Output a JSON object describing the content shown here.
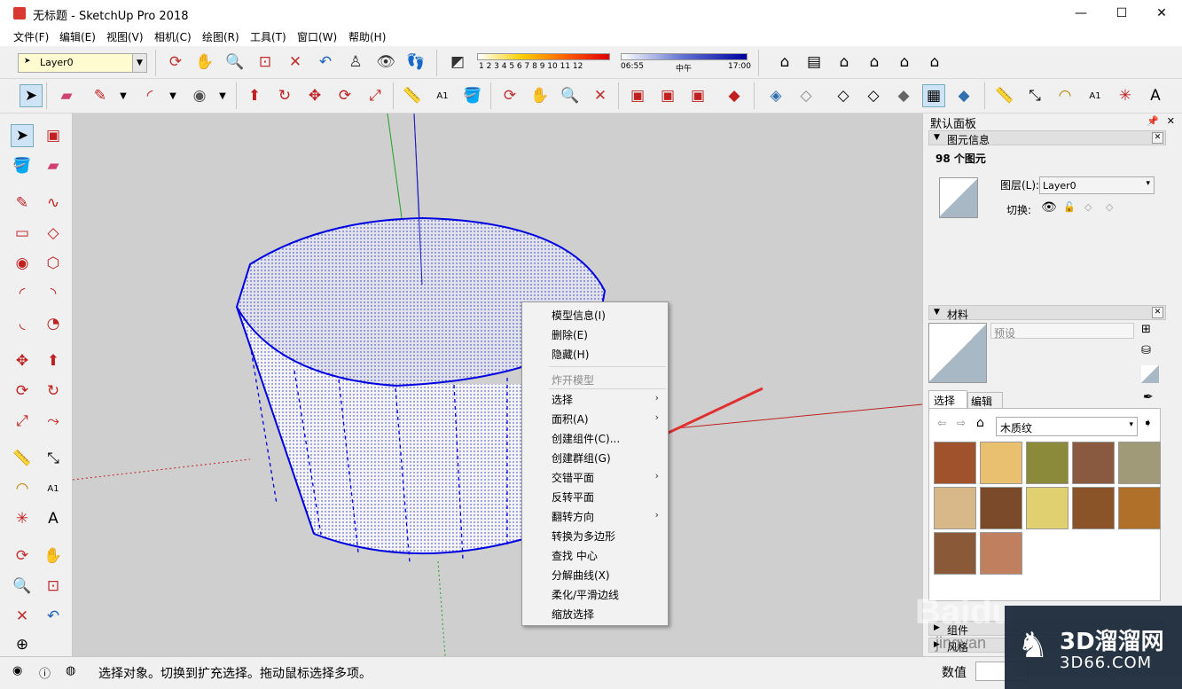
{
  "window": {
    "title": "无标题 - SketchUp Pro 2018",
    "minimize": "—",
    "maximize": "☐",
    "close": "✕"
  },
  "menu": [
    "文件(F)",
    "编辑(E)",
    "视图(V)",
    "相机(C)",
    "绘图(R)",
    "工具(T)",
    "窗口(W)",
    "帮助(H)"
  ],
  "layer_toolbar": {
    "current_layer": "Layer0"
  },
  "shadow_toolbar": {
    "months": "1 2 3 4 5 6 7 8 9 10 11 12",
    "time_start": "06:55",
    "time_mid": "中午",
    "time_end": "17:00"
  },
  "tray": {
    "title": "默认面板",
    "entity_info": {
      "header": "图元信息",
      "count": "98 个图元",
      "layer_label": "图层(L):",
      "layer_value": "Layer0",
      "toggle_label": "切换:"
    },
    "materials": {
      "header": "材料",
      "name_placeholder": "预设",
      "tab_select": "选择",
      "tab_edit": "编辑",
      "library": "木质纹"
    },
    "collapsed_panels": [
      "组件",
      "风格"
    ]
  },
  "context_menu": {
    "items": [
      {
        "label": "模型信息(I)",
        "submenu": false,
        "disabled": false
      },
      {
        "label": "删除(E)",
        "submenu": false,
        "disabled": false
      },
      {
        "label": "隐藏(H)",
        "submenu": false,
        "disabled": false
      },
      {
        "label": "炸开模型",
        "submenu": false,
        "disabled": true
      },
      {
        "label": "选择",
        "submenu": true,
        "disabled": false
      },
      {
        "label": "面积(A)",
        "submenu": true,
        "disabled": false
      },
      {
        "label": "创建组件(C)...",
        "submenu": false,
        "disabled": false
      },
      {
        "label": "创建群组(G)",
        "submenu": false,
        "disabled": false
      },
      {
        "label": "交错平面",
        "submenu": true,
        "disabled": false
      },
      {
        "label": "反转平面",
        "submenu": false,
        "disabled": false
      },
      {
        "label": "翻转方向",
        "submenu": true,
        "disabled": false
      },
      {
        "label": "转换为多边形",
        "submenu": false,
        "disabled": false
      },
      {
        "label": "查找 中心",
        "submenu": false,
        "disabled": false
      },
      {
        "label": "分解曲线(X)",
        "submenu": false,
        "disabled": false
      },
      {
        "label": "柔化/平滑边线",
        "submenu": false,
        "disabled": false
      },
      {
        "label": "缩放选择",
        "submenu": false,
        "disabled": false
      }
    ]
  },
  "status": {
    "message": "选择对象。切换到扩充选择。拖动鼠标选择多项。",
    "value_label": "数值",
    "value": ""
  },
  "watermark": {
    "line1": "3D溜溜网",
    "line2": "3D66.COM",
    "baidu": "Baidu",
    "jingyan": "jingyan"
  },
  "colors": {
    "selection_blue": "#0000e0",
    "annotation_red": "#e03030",
    "viewport_bg": "#cfcfcf"
  }
}
